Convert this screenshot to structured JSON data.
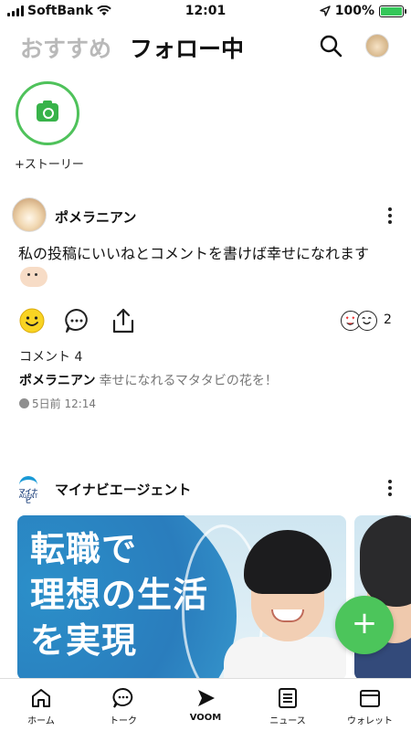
{
  "status_bar": {
    "carrier": "SoftBank",
    "time": "12:01",
    "battery": "100%",
    "battery_level": 1.0
  },
  "header": {
    "tab_recommended": "おすすめ",
    "tab_following": "フォロー中"
  },
  "story": {
    "label": "+ストーリー"
  },
  "post1": {
    "author": "ポメラニアン",
    "text": "私の投稿にいいねとコメントを書けば幸せになれます",
    "reaction_count": "2",
    "comment_count": "コメント 4",
    "comment_author": "ポメラニアン",
    "comment_text": "幸せになれるマタタビの花を！",
    "time": "5日前 12:14"
  },
  "post2": {
    "brand_logo_text": "マイナビ",
    "brand_logo_sub": "AGENT",
    "author": "マイナビエージェント",
    "ad_text": [
      "転職で",
      "理想の生活",
      "を実現"
    ]
  },
  "fab": {
    "label": "+"
  },
  "nav": {
    "home": "ホーム",
    "talk": "トーク",
    "voom": "VOOM",
    "news": "ニュース",
    "wallet": "ウォレット"
  },
  "colors": {
    "line_green": "#4cc55b",
    "inactive_tab": "#b9b9b9",
    "ad_blue": "#2a7dbd"
  }
}
